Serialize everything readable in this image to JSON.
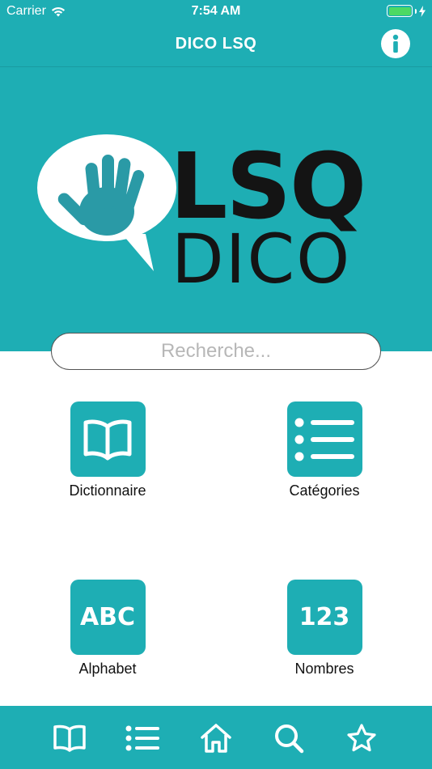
{
  "status_bar": {
    "carrier": "Carrier",
    "time": "7:54 AM",
    "icons": [
      "wifi-icon",
      "battery-icon",
      "charging-icon"
    ]
  },
  "nav": {
    "title": "DICO LSQ",
    "info_icon": "info-icon"
  },
  "logo": {
    "line1": "LSQ",
    "line2": "DICO",
    "icon": "hand-in-speech-bubble"
  },
  "search": {
    "placeholder": "Recherche...",
    "value": ""
  },
  "tiles": [
    {
      "label": "Dictionnaire",
      "icon": "book-icon"
    },
    {
      "label": "Catégories",
      "icon": "list-icon"
    },
    {
      "label": "Alphabet",
      "icon_text": "ABC"
    },
    {
      "label": "Nombres",
      "icon_text": "123"
    }
  ],
  "tab_bar": {
    "tabs": [
      "book-icon",
      "list-icon",
      "home-icon",
      "search-icon",
      "star-icon"
    ]
  },
  "colors": {
    "accent": "#1eaeb4",
    "logo_text": "#141414",
    "hand": "#2a9aa6",
    "battery": "#4cd964"
  }
}
